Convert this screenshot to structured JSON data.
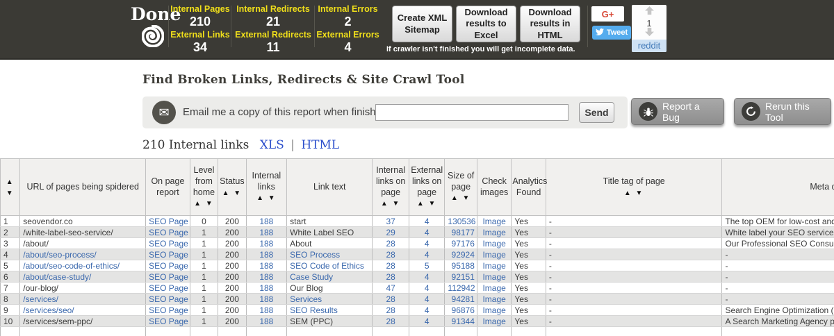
{
  "colors": {
    "topbar_bg": "#3b3a35",
    "stat_label_yellow": "#f0df1a",
    "link_blue": "#2b4ecb",
    "table_link_blue": "#3a68ad",
    "gplus_red": "#d84a38",
    "tweet_blue": "#55acee",
    "reddit_blue": "#4279b8",
    "row_stripe": "#e4e4e3"
  },
  "header": {
    "done_label": "Done",
    "stat_groups": [
      {
        "top": {
          "label": "Internal Pages",
          "value": "210"
        },
        "bottom": {
          "label": "External Links",
          "value": "34"
        }
      },
      {
        "top": {
          "label": "Internal Redirects",
          "value": "21"
        },
        "bottom": {
          "label": "External Redirects",
          "value": "11"
        }
      },
      {
        "top": {
          "label": "Internal Errors",
          "value": "2"
        },
        "bottom": {
          "label": "External Errors",
          "value": "4"
        }
      }
    ],
    "buttons": [
      {
        "label": "Create XML Sitemap"
      },
      {
        "label": "Download results to Excel"
      },
      {
        "label": "Download results in HTML"
      }
    ],
    "warning": "If crawler isn't finished you will get incomplete data.",
    "social": {
      "gplus_label": "G+",
      "tweet_label": "Tweet",
      "reddit_count": "1",
      "reddit_label": "reddit"
    }
  },
  "tool": {
    "title": "Find Broken Links, Redirects & Site Crawl Tool",
    "email_prompt": "Email me a copy of this report when finished:",
    "email_value": "",
    "send_label": "Send",
    "report_bug_label": "Report a Bug",
    "rerun_label": "Rerun this Tool"
  },
  "summary": {
    "count_text": "210 Internal links",
    "xls_label": "XLS",
    "separator": "|",
    "html_label": "HTML"
  },
  "table": {
    "sort_arrows": "▲ ▼",
    "columns": [
      {
        "key": "num",
        "label": "",
        "align": "left",
        "link": false,
        "sortable": true,
        "cell_interactable": false
      },
      {
        "key": "url",
        "label": "URL of pages being spidered",
        "align": "left",
        "link": false,
        "sortable": false,
        "cell_interactable": true
      },
      {
        "key": "report",
        "label": "On page report",
        "align": "center",
        "link": true,
        "sortable": false,
        "cell_interactable": true
      },
      {
        "key": "level",
        "label": "Level from home",
        "align": "center",
        "link": false,
        "sortable": true,
        "cell_interactable": false
      },
      {
        "key": "status",
        "label": "Status",
        "align": "center",
        "link": false,
        "sortable": true,
        "cell_interactable": false
      },
      {
        "key": "internal_links",
        "label": "Internal links",
        "align": "center",
        "link": true,
        "sortable": true,
        "cell_interactable": true
      },
      {
        "key": "link_text",
        "label": "Link text",
        "align": "left",
        "link": false,
        "sortable": false,
        "cell_interactable": true
      },
      {
        "key": "int_on_page",
        "label": "Internal links on page",
        "align": "center",
        "link": true,
        "sortable": true,
        "cell_interactable": true
      },
      {
        "key": "ext_on_page",
        "label": "External links on page",
        "align": "center",
        "link": true,
        "sortable": true,
        "cell_interactable": true
      },
      {
        "key": "size",
        "label": "Size of page",
        "align": "right",
        "link": true,
        "sortable": true,
        "cell_interactable": true
      },
      {
        "key": "check_images",
        "label": "Check images",
        "align": "center",
        "link": true,
        "sortable": false,
        "cell_interactable": true
      },
      {
        "key": "analytics",
        "label": "Analytics Found",
        "align": "left",
        "link": false,
        "sortable": false,
        "cell_interactable": false
      },
      {
        "key": "title_tag",
        "label": "Title tag of page",
        "align": "left",
        "link": false,
        "sortable": true,
        "cell_interactable": false
      },
      {
        "key": "meta_desc",
        "label": "Meta description",
        "align": "left",
        "link": false,
        "sortable": false,
        "cell_interactable": false
      }
    ],
    "rows": [
      {
        "num": "1",
        "url": "seovendor.co",
        "url_state": "dark",
        "report": "SEO Page",
        "level": "0",
        "status": "200",
        "internal_links": "188",
        "link_text": "start",
        "int_on_page": "37",
        "ext_on_page": "4",
        "size": "130536",
        "check_images": "Image",
        "analytics": "Yes",
        "title_tag": "-",
        "meta_desc": "The top OEM for low-cost and re"
      },
      {
        "num": "2",
        "url": "/white-label-seo-service/",
        "url_state": "dark",
        "report": "SEO Page",
        "level": "1",
        "status": "200",
        "internal_links": "188",
        "link_text": "White Label SEO",
        "int_on_page": "29",
        "ext_on_page": "4",
        "size": "98177",
        "check_images": "Image",
        "analytics": "Yes",
        "title_tag": "-",
        "meta_desc": "White label your SEO services wi"
      },
      {
        "num": "3",
        "url": "/about/",
        "url_state": "dark",
        "report": "SEO Page",
        "level": "1",
        "status": "200",
        "internal_links": "188",
        "link_text": "About",
        "int_on_page": "28",
        "ext_on_page": "4",
        "size": "97176",
        "check_images": "Image",
        "analytics": "Yes",
        "title_tag": "-",
        "meta_desc": "Our Professional SEO Consultant"
      },
      {
        "num": "4",
        "url": "/about/seo-process/",
        "url_state": "blue",
        "report": "SEO Page",
        "level": "1",
        "status": "200",
        "internal_links": "188",
        "link_text": "SEO Process",
        "int_on_page": "28",
        "ext_on_page": "4",
        "size": "92924",
        "check_images": "Image",
        "analytics": "Yes",
        "title_tag": "-",
        "meta_desc": "-"
      },
      {
        "num": "5",
        "url": "/about/seo-code-of-ethics/",
        "url_state": "blue",
        "report": "SEO Page",
        "level": "1",
        "status": "200",
        "internal_links": "188",
        "link_text": "SEO Code of Ethics",
        "int_on_page": "28",
        "ext_on_page": "5",
        "size": "95188",
        "check_images": "Image",
        "analytics": "Yes",
        "title_tag": "-",
        "meta_desc": "-"
      },
      {
        "num": "6",
        "url": "/about/case-study/",
        "url_state": "blue",
        "report": "SEO Page",
        "level": "1",
        "status": "200",
        "internal_links": "188",
        "link_text": "Case Study",
        "int_on_page": "28",
        "ext_on_page": "4",
        "size": "92151",
        "check_images": "Image",
        "analytics": "Yes",
        "title_tag": "-",
        "meta_desc": "-"
      },
      {
        "num": "7",
        "url": "/our-blog/",
        "url_state": "dark",
        "report": "SEO Page",
        "level": "1",
        "status": "200",
        "internal_links": "188",
        "link_text": "Our Blog",
        "int_on_page": "47",
        "ext_on_page": "4",
        "size": "112942",
        "check_images": "Image",
        "analytics": "Yes",
        "title_tag": "-",
        "meta_desc": "-"
      },
      {
        "num": "8",
        "url": "/services/",
        "url_state": "blue",
        "report": "SEO Page",
        "level": "1",
        "status": "200",
        "internal_links": "188",
        "link_text": "Services",
        "int_on_page": "28",
        "ext_on_page": "4",
        "size": "94281",
        "check_images": "Image",
        "analytics": "Yes",
        "title_tag": "-",
        "meta_desc": "-"
      },
      {
        "num": "9",
        "url": "/services/seo/",
        "url_state": "blue",
        "report": "SEO Page",
        "level": "1",
        "status": "200",
        "internal_links": "188",
        "link_text": "SEO Results",
        "int_on_page": "28",
        "ext_on_page": "4",
        "size": "96876",
        "check_images": "Image",
        "analytics": "Yes",
        "title_tag": "-",
        "meta_desc": "Search Engine Optimization (SEO"
      },
      {
        "num": "10",
        "url": "/services/sem-ppc/",
        "url_state": "dark",
        "report": "SEO Page",
        "level": "1",
        "status": "200",
        "internal_links": "188",
        "link_text": "SEM (PPC)",
        "int_on_page": "28",
        "ext_on_page": "4",
        "size": "91344",
        "check_images": "Image",
        "analytics": "Yes",
        "title_tag": "-",
        "meta_desc": "A Search Marketing Agency prom"
      }
    ]
  }
}
